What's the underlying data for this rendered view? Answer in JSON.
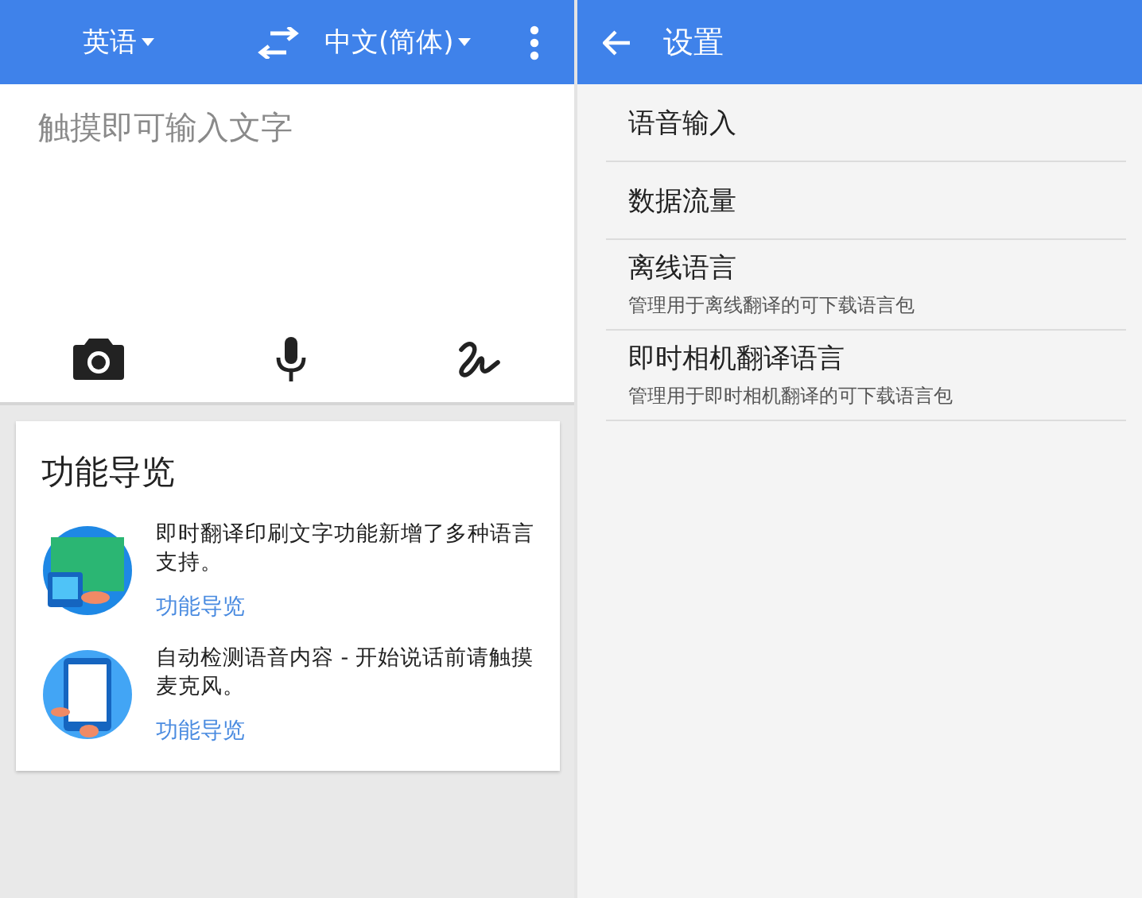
{
  "translator": {
    "source_language": "英语",
    "target_language": "中文(简体)",
    "input": {
      "placeholder": "触摸即可输入文字"
    },
    "feature_tour": {
      "title": "功能导览",
      "items": [
        {
          "kind": "camera",
          "text": "即时翻译印刷文字功能新增了多种语言支持。",
          "link": "功能导览"
        },
        {
          "kind": "voice",
          "text": "自动检测语音内容 - 开始说话前请触摸麦克风。",
          "link": "功能导览"
        }
      ]
    }
  },
  "settings": {
    "title": "设置",
    "items": [
      {
        "title": "语音输入"
      },
      {
        "title": "数据流量"
      },
      {
        "title": "离线语言",
        "subtitle": "管理用于离线翻译的可下载语言包"
      },
      {
        "title": "即时相机翻译语言",
        "subtitle": "管理用于即时相机翻译的可下载语言包"
      }
    ]
  }
}
